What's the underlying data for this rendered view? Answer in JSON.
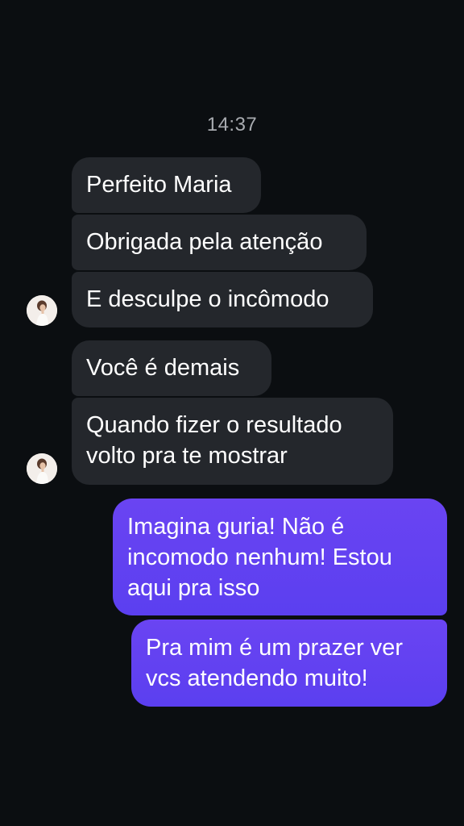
{
  "chat": {
    "timestamp": "14:37",
    "incoming": [
      {
        "text": "Perfeito Maria"
      },
      {
        "text": "Obrigada pela atenção"
      },
      {
        "text": "E desculpe o incômodo"
      },
      {
        "text": "Você é demais"
      },
      {
        "text": "Quando fizer o resultado\nvolto pra te mostrar"
      }
    ],
    "outgoing": [
      {
        "text": "Imagina guria! Não é\nincomodo nenhum! Estou\naqui pra isso"
      },
      {
        "text": "Pra mim é um prazer ver\nvcs atendendo muito!"
      }
    ],
    "avatar": {
      "icon": "contact-avatar"
    },
    "colors": {
      "background": "#0b0e11",
      "incoming_bubble": "#24272c",
      "outgoing_bubble": "#6a44f2",
      "timestamp_text": "#a8abb0"
    }
  }
}
